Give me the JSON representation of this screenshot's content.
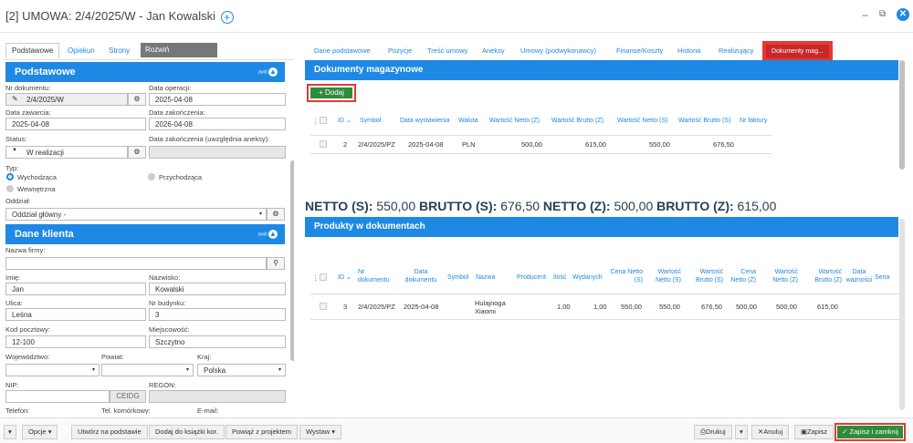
{
  "window": {
    "title": "[2] UMOWA: 2/4/2025/W - Jan Kowalski",
    "add_glyph": "+",
    "minimize": "−",
    "restore": "⧉",
    "close": "✕"
  },
  "left": {
    "tabs": [
      "Podstawowe",
      "Opiekun",
      "Strony"
    ],
    "rozwin": "Rozwiń",
    "section_basic": "Podstawowe",
    "collapse_label": "zwiń",
    "nr_dokumentu_label": "Nr dokumentu:",
    "nr_dokumentu": "2/4/2025/W",
    "data_operacji_label": "Data operacji:",
    "data_operacji": "2025-04-08",
    "data_zawarcia_label": "Data zawarcia:",
    "data_zawarcia": "2025-04-08",
    "data_zakonczenia_label": "Data zakończenia:",
    "data_zakonczenia": "2026-04-08",
    "status_label": "Status:",
    "status": "W realizacji",
    "data_zak_aneksy_label": "Data zakończenia (uwzględnia aneksy):",
    "typ_label": "Typ:",
    "typ_options": [
      "Wychodząca",
      "Przychodząca",
      "Wewnętrzna"
    ],
    "oddzial_label": "Oddział:",
    "oddzial": "Oddział główny -",
    "section_client": "Dane klienta",
    "nazwa_firmy_label": "Nazwa firmy:",
    "imie_label": "Imię:",
    "imie": "Jan",
    "nazwisko_label": "Nazwisko:",
    "nazwisko": "Kowalski",
    "ulica_label": "Ulica:",
    "ulica": "Leśna",
    "nr_budynku_label": "Nr budynku:",
    "nr_budynku": "3",
    "kod_label": "Kod pocztowy:",
    "kod": "12-100",
    "miejscowosc_label": "Miejscowość:",
    "miejscowosc": "Szczytno",
    "wojewodztwo_label": "Województwo:",
    "powiat_label": "Powiat:",
    "kraj_label": "Kraj:",
    "kraj": "Polska",
    "nip_label": "NIP:",
    "ceidg": "CEIDG",
    "regon_label": "REGON:",
    "telefon_label": "Telefon:",
    "tel_kom_label": "Tel. komórkowy:",
    "email_label": "E-mail:"
  },
  "right": {
    "tabs": [
      "Dane podstawowe",
      "Pozycje",
      "Treść umowy",
      "Aneksy",
      "Umowy (podwykonawcy)",
      "Finanse/Koszty",
      "Historia",
      "Realizujący",
      "Dokumenty mag..."
    ],
    "docs_title": "Dokumenty magazynowe",
    "add_button": "+ Dodaj",
    "docs_headers": [
      "ID",
      "Symbol",
      "Data wystawienia",
      "Waluta",
      "Wartość Netto (Z)",
      "Wartość Brutto (Z)",
      "Wartość Netto (S)",
      "Wartość Brutto (S)",
      "Nr faktury"
    ],
    "docs_row": [
      "2",
      "2/4/2025/PZ",
      "2025-04-08",
      "PLN",
      "500,00",
      "615,00",
      "550,00",
      "676,50",
      ""
    ],
    "totals": {
      "netto_s_label": "NETTO (S):",
      "netto_s": "550,00",
      "brutto_s_label": "BRUTTO (S):",
      "brutto_s": "676,50",
      "netto_z_label": "NETTO (Z):",
      "netto_z": "500,00",
      "brutto_z_label": "BRUTTO (Z):",
      "brutto_z": "615,00"
    },
    "products_title": "Produkty w dokumentach",
    "prod_headers": [
      "ID",
      "Nr dokumentu",
      "Data dokumentu",
      "Symbol",
      "Nazwa",
      "Producent",
      "Ilość",
      "Wydanych",
      "Cena Netto (S)",
      "Wartość Netto (S)",
      "Wartość Brutto (S)",
      "Cena Netto (Z)",
      "Wartość Netto (Z)",
      "Wartość Brutto (Z)",
      "Data ważności",
      "Seria"
    ],
    "prod_row": [
      "3",
      "2/4/2025/PZ",
      "2025-04-08",
      "",
      "Hulajnoga Xiaomi",
      "",
      "1,00",
      "1,00",
      "550,00",
      "550,00",
      "676,50",
      "500,00",
      "500,00",
      "615,00",
      "",
      ""
    ]
  },
  "footer": {
    "opcje": "Opcje",
    "utworz": "Utwórz na podstawie",
    "dodaj_ksiazki": "Dodaj do książki kor.",
    "powiaz": "Powiąż z projektem",
    "wystaw": "Wystaw",
    "drukuj": "Drukuj",
    "anuluj": "Anuluj",
    "zapisz": "Zapisz",
    "zapisz_zamknij": "✓ Zapisz i zamknij"
  },
  "colors": {
    "accent": "#1e88e5",
    "success": "#2e8b3a",
    "highlight": "#e53935"
  }
}
